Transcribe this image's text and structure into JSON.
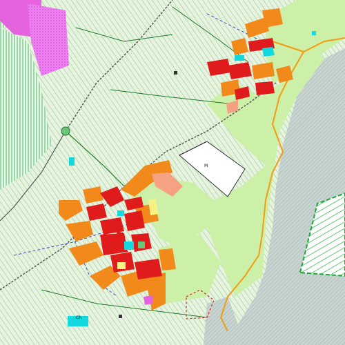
{
  "map": {
    "labels": {
      "plot_m": "M",
      "road_marker": "Ch"
    },
    "palette": {
      "background_agri": "#e4efe0",
      "hatch_green": "#a5d69a",
      "hatch_gray": "#b9c5bd",
      "light_green": "#ccf0a8",
      "residential_red": "#e01b1b",
      "residential_orange": "#f28a1b",
      "salmon": "#f4a184",
      "pink_magenta": "#e563de",
      "cyan": "#14d8df",
      "yellow": "#f6f285",
      "water_gray": "#a9bbc1",
      "forest_green": "#66c77a",
      "road_dark": "#555555",
      "boundary_orange": "#f49b0f",
      "boundary_green": "#1ba53a",
      "dashed_blue": "#3b4fc6",
      "dashed_red": "#d42424",
      "white_plot": "#ffffff"
    }
  }
}
